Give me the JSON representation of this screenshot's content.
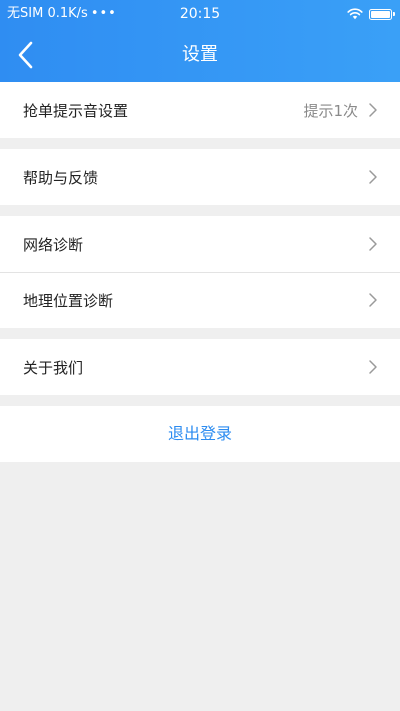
{
  "status_bar": {
    "carrier": "无SIM",
    "speed": "0.1K/s",
    "dots": "•••",
    "time": "20:15",
    "battery_level": 1.0
  },
  "nav": {
    "title": "设置",
    "back_icon": "chevron-left-icon"
  },
  "settings": {
    "grab_sound": {
      "label": "抢单提示音设置",
      "value": "提示1次"
    },
    "help_feedback": {
      "label": "帮助与反馈"
    },
    "network_diagnosis": {
      "label": "网络诊断"
    },
    "location_diagnosis": {
      "label": "地理位置诊断"
    },
    "about_us": {
      "label": "关于我们"
    }
  },
  "logout": {
    "label": "退出登录"
  },
  "colors": {
    "header": "#3596f4",
    "background": "#efefef",
    "logout_text": "#2d8cf0"
  }
}
